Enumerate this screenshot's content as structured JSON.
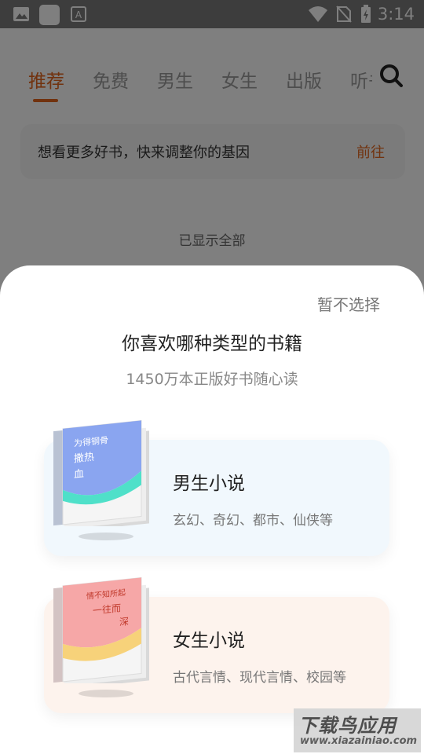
{
  "status_bar": {
    "time": "3:14"
  },
  "tabs": [
    {
      "label": "推荐"
    },
    {
      "label": "免费"
    },
    {
      "label": "男生"
    },
    {
      "label": "女生"
    },
    {
      "label": "出版"
    },
    {
      "label": "听书"
    }
  ],
  "banner": {
    "text": "想看更多好书，快来调整你的基因",
    "action": "前往"
  },
  "list_end_text": "已显示全部",
  "sheet": {
    "skip_label": "暂不选择",
    "title": "你喜欢哪种类型的书籍",
    "subtitle": "1450万本正版好书随心读",
    "options": [
      {
        "name": "男生小说",
        "desc": "玄幻、奇幻、都市、仙侠等",
        "cover_title": "为骨钢骨撒热血",
        "cover_lines": [
          "为得钢骨",
          "撒热",
          "血"
        ]
      },
      {
        "name": "女生小说",
        "desc": "古代言情、现代言情、校园等",
        "cover_title": "情不知所起一往而深",
        "cover_lines": [
          "情不知所起",
          "一往而",
          "深"
        ]
      }
    ]
  },
  "watermark": {
    "title": "下载鸟应用",
    "url": "www.xiazainiao.com"
  },
  "colors": {
    "accent": "#e2651c",
    "male_card": "#f1f8fd",
    "female_card": "#fdf3ed"
  }
}
